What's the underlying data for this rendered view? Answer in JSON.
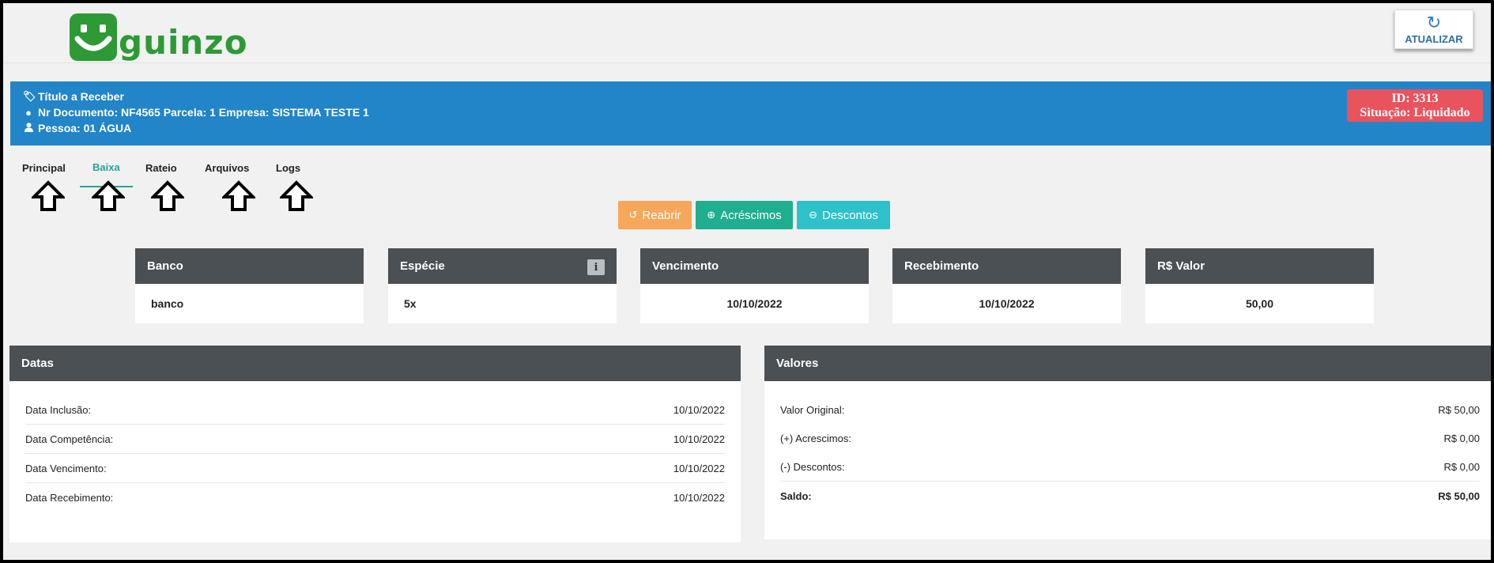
{
  "brand": {
    "name": "guinzo",
    "color": "#2e9a36"
  },
  "toolbar": {
    "refresh_label": "ATUALIZAR",
    "refresh_icon": "refresh-icon"
  },
  "banner": {
    "title": "Título a Receber",
    "document_line": "Nr Documento: NF4565 Parcela: 1 Empresa: SISTEMA TESTE 1",
    "person_line": "Pessoa: 01 ÁGUA",
    "id_text": "ID: 3313",
    "status_text": "Situação: Liquidado",
    "color": "#2185c8",
    "badge_color": "#e9535e"
  },
  "tabs": [
    {
      "label": "Principal",
      "active": false
    },
    {
      "label": "Baixa",
      "active": true
    },
    {
      "label": "Rateio",
      "active": false
    },
    {
      "label": "Arquivos",
      "active": false
    },
    {
      "label": "Logs",
      "active": false
    }
  ],
  "actions": {
    "reopen_label": "Reabrir",
    "additions_label": "Acréscimos",
    "discounts_label": "Descontos",
    "colors": {
      "reopen": "#f7a75a",
      "additions": "#1fae8f",
      "discounts": "#2dc1c9"
    }
  },
  "summary": {
    "bank": {
      "header": "Banco",
      "value": "banco"
    },
    "species": {
      "header": "Espécie",
      "value": "5x"
    },
    "due": {
      "header": "Vencimento",
      "value": "10/10/2022"
    },
    "received": {
      "header": "Recebimento",
      "value": "10/10/2022"
    },
    "amount": {
      "header": "R$ Valor",
      "value": "50,00"
    }
  },
  "dates_panel": {
    "title": "Datas",
    "rows": [
      {
        "label": "Data Inclusão:",
        "value": "10/10/2022"
      },
      {
        "label": "Data Competência:",
        "value": "10/10/2022"
      },
      {
        "label": "Data Vencimento:",
        "value": "10/10/2022"
      },
      {
        "label": "Data Recebimento:",
        "value": "10/10/2022"
      }
    ]
  },
  "values_panel": {
    "title": "Valores",
    "rows": [
      {
        "label": "Valor Original:",
        "value": "R$ 50,00"
      },
      {
        "label": "(+) Acrescimos:",
        "value": "R$ 0,00"
      },
      {
        "label": "(-) Descontos:",
        "value": "R$ 0,00"
      },
      {
        "label": "Saldo:",
        "value": "R$ 50,00"
      }
    ]
  }
}
